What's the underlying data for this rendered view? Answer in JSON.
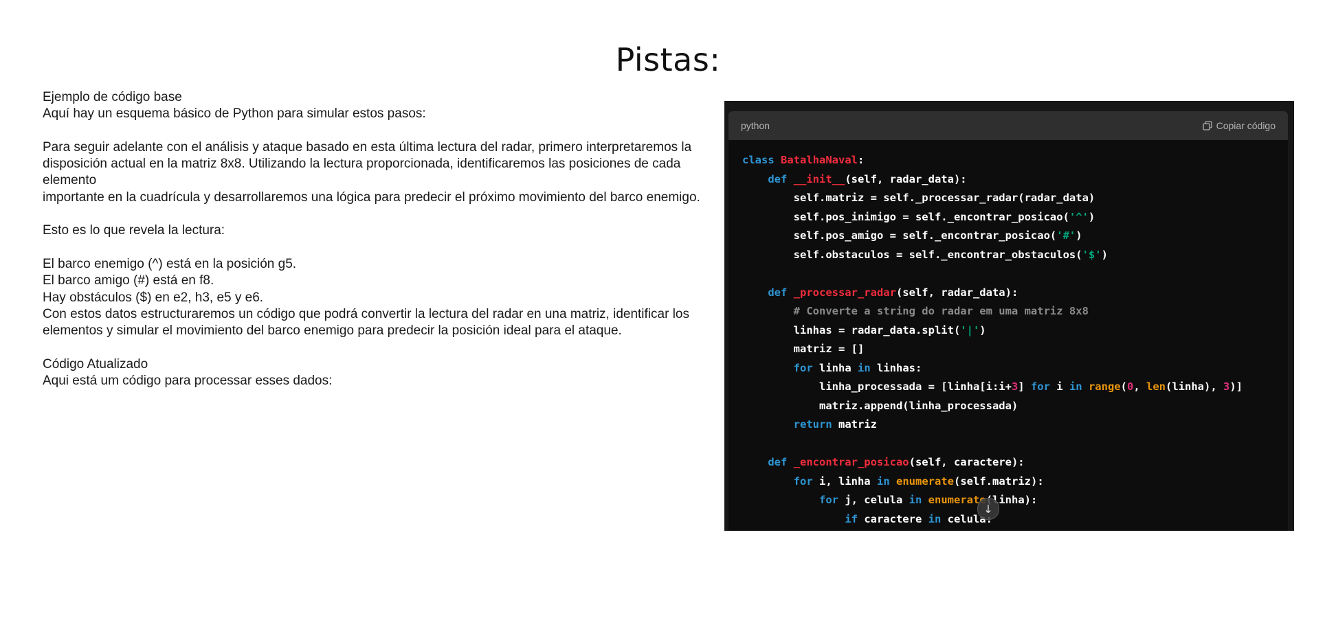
{
  "slide": {
    "title": "Pistas:"
  },
  "text": {
    "line1": "Ejemplo de código base",
    "line2": "Aquí hay un esquema básico de Python para simular estos pasos:",
    "line3": "Para seguir adelante con el análisis y ataque basado en esta última lectura del radar, primero interpretaremos la",
    "line4": "disposición actual en la matriz 8x8. Utilizando la lectura proporcionada, identificaremos las posiciones de cada elemento",
    "line5": "importante en la cuadrícula y desarrollaremos una lógica para predecir el próximo movimiento del barco enemigo.",
    "line6": "Esto es lo que revela la lectura:",
    "line7": "El barco enemigo (^) está en la posición g5.",
    "line8": "El barco amigo (#) está en f8.",
    "line9": "Hay obstáculos ($) en e2, h3, e5 y e6.",
    "line10": "Con estos datos estructuraremos un código que podrá convertir la lectura del radar en una matriz, identificar los",
    "line11": "elementos y simular el movimiento del barco enemigo para predecir la posición ideal para el ataque.",
    "line12": "Código Atualizado",
    "line13": "Aqui está um código para processar esses dados:"
  },
  "code_block": {
    "language": "python",
    "copy_label": "Copiar código",
    "copy_icon": "copy-icon",
    "scroll_icon": "arrow-down-icon",
    "lines": [
      [
        [
          "kw",
          "class "
        ],
        [
          "fn",
          "BatalhaNaval"
        ],
        [
          "p",
          ":"
        ]
      ],
      [
        [
          "p",
          "    "
        ],
        [
          "kw",
          "def "
        ],
        [
          "fn",
          "__init__"
        ],
        [
          "p",
          "(self, radar_data):"
        ]
      ],
      [
        [
          "p",
          "        self.matriz = self._processar_radar(radar_data)"
        ]
      ],
      [
        [
          "p",
          "        self.pos_inimigo = self._encontrar_posicao("
        ],
        [
          "str",
          "'^'"
        ],
        [
          "p",
          ")"
        ]
      ],
      [
        [
          "p",
          "        self.pos_amigo = self._encontrar_posicao("
        ],
        [
          "str",
          "'#'"
        ],
        [
          "p",
          ")"
        ]
      ],
      [
        [
          "p",
          "        self.obstaculos = self._encontrar_obstaculos("
        ],
        [
          "str",
          "'$'"
        ],
        [
          "p",
          ")"
        ]
      ],
      [
        [
          "p",
          ""
        ]
      ],
      [
        [
          "p",
          "    "
        ],
        [
          "kw",
          "def "
        ],
        [
          "fn",
          "_processar_radar"
        ],
        [
          "p",
          "(self, radar_data):"
        ]
      ],
      [
        [
          "cm",
          "        # Converte a string do radar em uma matriz 8x8"
        ]
      ],
      [
        [
          "p",
          "        linhas = radar_data.split("
        ],
        [
          "str",
          "'|'"
        ],
        [
          "p",
          ")"
        ]
      ],
      [
        [
          "p",
          "        matriz = []"
        ]
      ],
      [
        [
          "p",
          "        "
        ],
        [
          "kw",
          "for"
        ],
        [
          "p",
          " linha "
        ],
        [
          "kw",
          "in"
        ],
        [
          "p",
          " linhas:"
        ]
      ],
      [
        [
          "p",
          "            linha_processada = [linha[i:i+"
        ],
        [
          "num",
          "3"
        ],
        [
          "p",
          "] "
        ],
        [
          "kw",
          "for"
        ],
        [
          "p",
          " i "
        ],
        [
          "kw",
          "in"
        ],
        [
          "p",
          " "
        ],
        [
          "bi",
          "range"
        ],
        [
          "p",
          "("
        ],
        [
          "num",
          "0"
        ],
        [
          "p",
          ", "
        ],
        [
          "bi",
          "len"
        ],
        [
          "p",
          "(linha), "
        ],
        [
          "num",
          "3"
        ],
        [
          "p",
          ")]"
        ]
      ],
      [
        [
          "p",
          "            matriz.append(linha_processada)"
        ]
      ],
      [
        [
          "p",
          "        "
        ],
        [
          "kw",
          "return"
        ],
        [
          "p",
          " matriz"
        ]
      ],
      [
        [
          "p",
          ""
        ]
      ],
      [
        [
          "p",
          "    "
        ],
        [
          "kw",
          "def "
        ],
        [
          "fn",
          "_encontrar_posicao"
        ],
        [
          "p",
          "(self, caractere):"
        ]
      ],
      [
        [
          "p",
          "        "
        ],
        [
          "kw",
          "for"
        ],
        [
          "p",
          " i, linha "
        ],
        [
          "kw",
          "in"
        ],
        [
          "p",
          " "
        ],
        [
          "bi",
          "enumerate"
        ],
        [
          "p",
          "(self.matriz):"
        ]
      ],
      [
        [
          "p",
          "            "
        ],
        [
          "kw",
          "for"
        ],
        [
          "p",
          " j, celula "
        ],
        [
          "kw",
          "in"
        ],
        [
          "p",
          " "
        ],
        [
          "bi",
          "enumerate"
        ],
        [
          "p",
          "(linha):"
        ]
      ],
      [
        [
          "p",
          "                "
        ],
        [
          "kw",
          "if"
        ],
        [
          "p",
          " caractere "
        ],
        [
          "kw",
          "in"
        ],
        [
          "p",
          " celula:"
        ]
      ]
    ]
  }
}
